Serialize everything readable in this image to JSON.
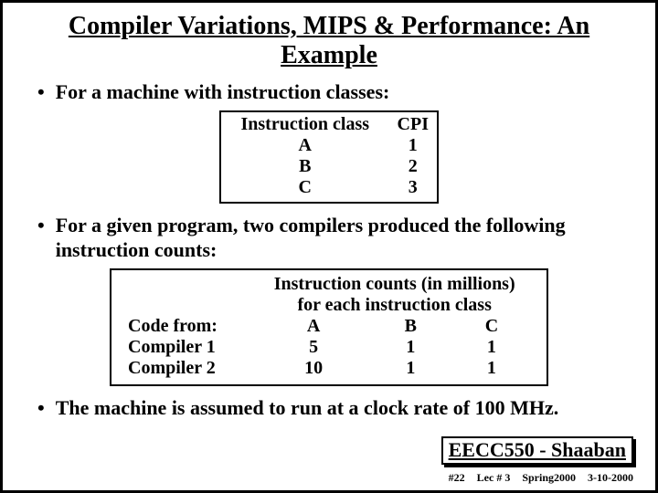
{
  "title": "Compiler Variations, MIPS & Performance: An Example",
  "bullets": {
    "b1": "For a machine with instruction classes:",
    "b2": "For a given program, two compilers produced the following instruction counts:",
    "b3": "The machine is assumed to run at a clock rate of 100 MHz."
  },
  "cpi_table": {
    "head_class": "Instruction class",
    "head_cpi": "CPI",
    "rows": [
      {
        "cls": "A",
        "cpi": "1"
      },
      {
        "cls": "B",
        "cpi": "2"
      },
      {
        "cls": "C",
        "cpi": "3"
      }
    ]
  },
  "counts_table": {
    "header1": "Instruction counts (in millions)",
    "header2": "for each instruction class",
    "code_from": "Code from:",
    "colA": "A",
    "colB": "B",
    "colC": "C",
    "rows": [
      {
        "label": "Compiler 1",
        "A": "5",
        "B": "1",
        "C": "1"
      },
      {
        "label": "Compiler 2",
        "A": "10",
        "B": "1",
        "C": "1"
      }
    ]
  },
  "footer": {
    "course": "EECC550 - Shaaban",
    "pg": "#22",
    "lec": "Lec # 3",
    "term": "Spring2000",
    "date": "3-10-2000"
  }
}
